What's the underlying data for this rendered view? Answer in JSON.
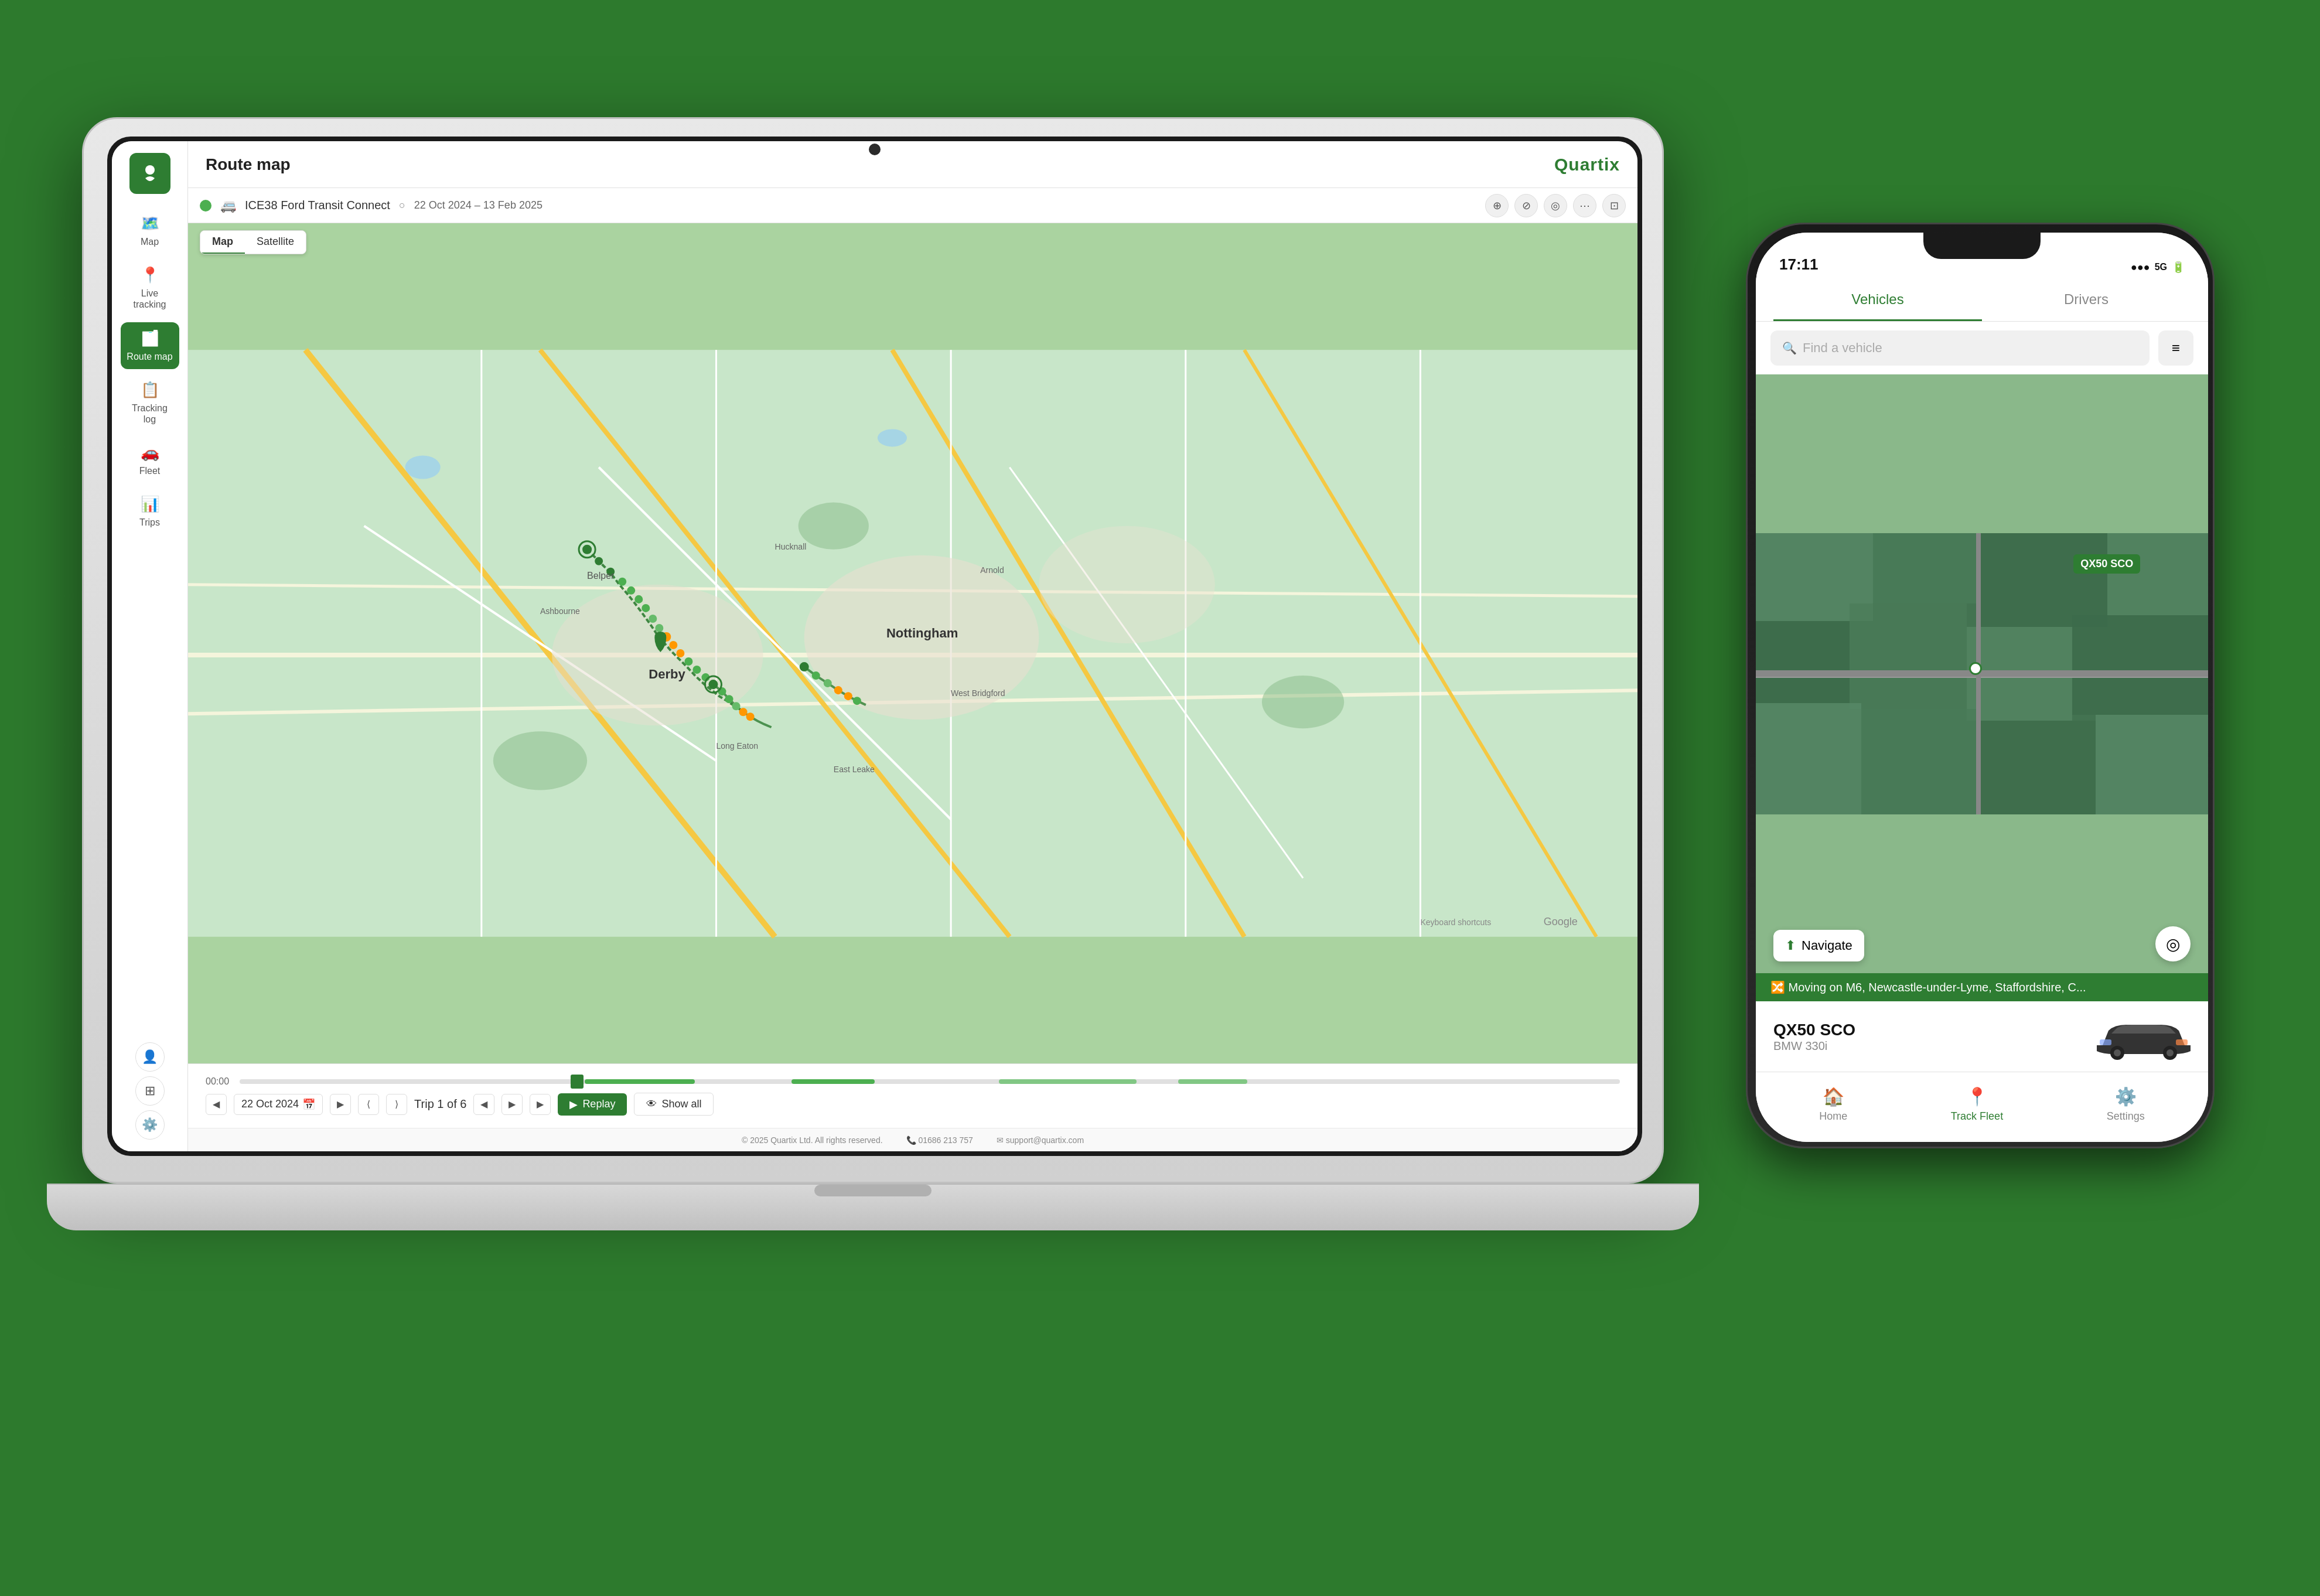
{
  "background_color": "#2d7a2d",
  "laptop": {
    "app": {
      "title": "Route map",
      "brand": "Quartix",
      "vehicle": {
        "name": "ICE38 Ford Transit Connect",
        "date_range": "22 Oct 2024 – 13 Feb 2025",
        "status_color": "#4caf50"
      },
      "map": {
        "tab_map": "Map",
        "tab_satellite": "Satellite"
      },
      "sidebar": {
        "items": [
          {
            "id": "map",
            "label": "Map",
            "icon": "🗺️",
            "active": false
          },
          {
            "id": "live-tracking",
            "label": "Live tracking",
            "icon": "📍",
            "active": false
          },
          {
            "id": "route-map",
            "label": "Route map",
            "icon": "🗂️",
            "active": true
          },
          {
            "id": "tracking-log",
            "label": "Tracking log",
            "icon": "📋",
            "active": false
          },
          {
            "id": "fleet",
            "label": "Fleet",
            "icon": "🚗",
            "active": false
          },
          {
            "id": "trips",
            "label": "Trips",
            "icon": "📊",
            "active": false
          }
        ],
        "bottom_items": [
          {
            "id": "profile",
            "icon": "👤"
          },
          {
            "id": "grid",
            "icon": "⊞"
          },
          {
            "id": "settings",
            "icon": "⚙️"
          }
        ]
      },
      "controls": {
        "date": "22 Oct 2024",
        "trip_label": "Trip 1 of 6",
        "replay_label": "Replay",
        "show_all_label": "Show all",
        "time_start": "00:00"
      },
      "footer": {
        "copyright": "© 2025 Quartix Ltd. All rights reserved.",
        "phone": "📞 01686 213 757",
        "email": "✉ support@quartix.com"
      }
    }
  },
  "phone": {
    "status_bar": {
      "time": "17:11",
      "icons": "●●● 5G 🔋"
    },
    "tabs": {
      "vehicles": "Vehicles",
      "drivers": "Drivers"
    },
    "search": {
      "placeholder": "Find a vehicle"
    },
    "vehicle": {
      "label": "QX50 SCO",
      "status_text": "Moving on M6, Newcastle-under-Lyme, Staffordshire, C...",
      "name": "QX50 SCO",
      "model": "BMW 330i"
    },
    "nav_btn": {
      "navigate": "Navigate"
    },
    "bottom_nav": [
      {
        "id": "home",
        "label": "Home",
        "icon": "🏠",
        "active": false
      },
      {
        "id": "track-fleet",
        "label": "Track Fleet",
        "icon": "📍",
        "active": true
      },
      {
        "id": "settings",
        "label": "Settings",
        "icon": "⚙️",
        "active": false
      }
    ]
  }
}
